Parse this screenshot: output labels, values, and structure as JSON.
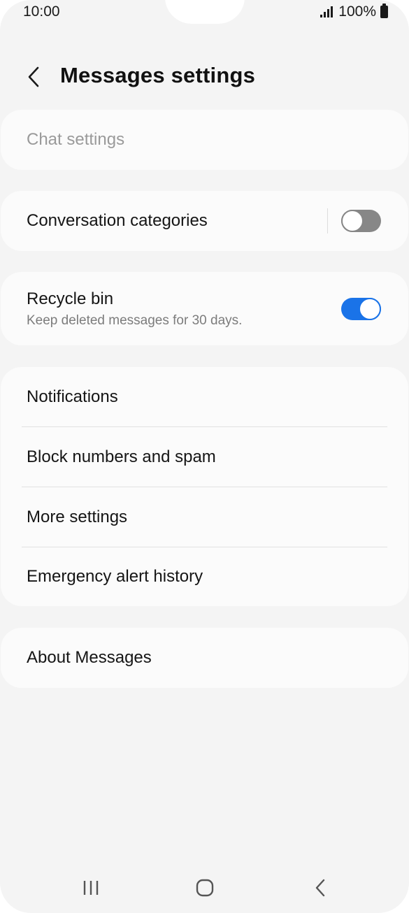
{
  "status": {
    "time": "10:00",
    "battery": "100%",
    "icons": [
      "signal-icon",
      "battery-icon"
    ]
  },
  "header": {
    "back_icon": "chevron-left-icon",
    "title": "Messages settings"
  },
  "chat_settings": {
    "label": "Chat settings",
    "enabled": false
  },
  "conversation_categories": {
    "label": "Conversation categories",
    "toggle_on": false
  },
  "recycle_bin": {
    "label": "Recycle bin",
    "sublabel": "Keep deleted messages for 30 days.",
    "toggle_on": true
  },
  "menu_group": {
    "items": [
      {
        "label": "Notifications"
      },
      {
        "label": "Block numbers and spam"
      },
      {
        "label": "More settings"
      },
      {
        "label": "Emergency alert history"
      }
    ]
  },
  "about": {
    "label": "About Messages"
  },
  "nav": {
    "icons": [
      "recent-apps-icon",
      "home-icon",
      "back-icon"
    ]
  },
  "colors": {
    "accent": "#1a73e8",
    "toggle_off": "#878787",
    "background": "#f4f4f4",
    "card": "#fbfbfb"
  }
}
